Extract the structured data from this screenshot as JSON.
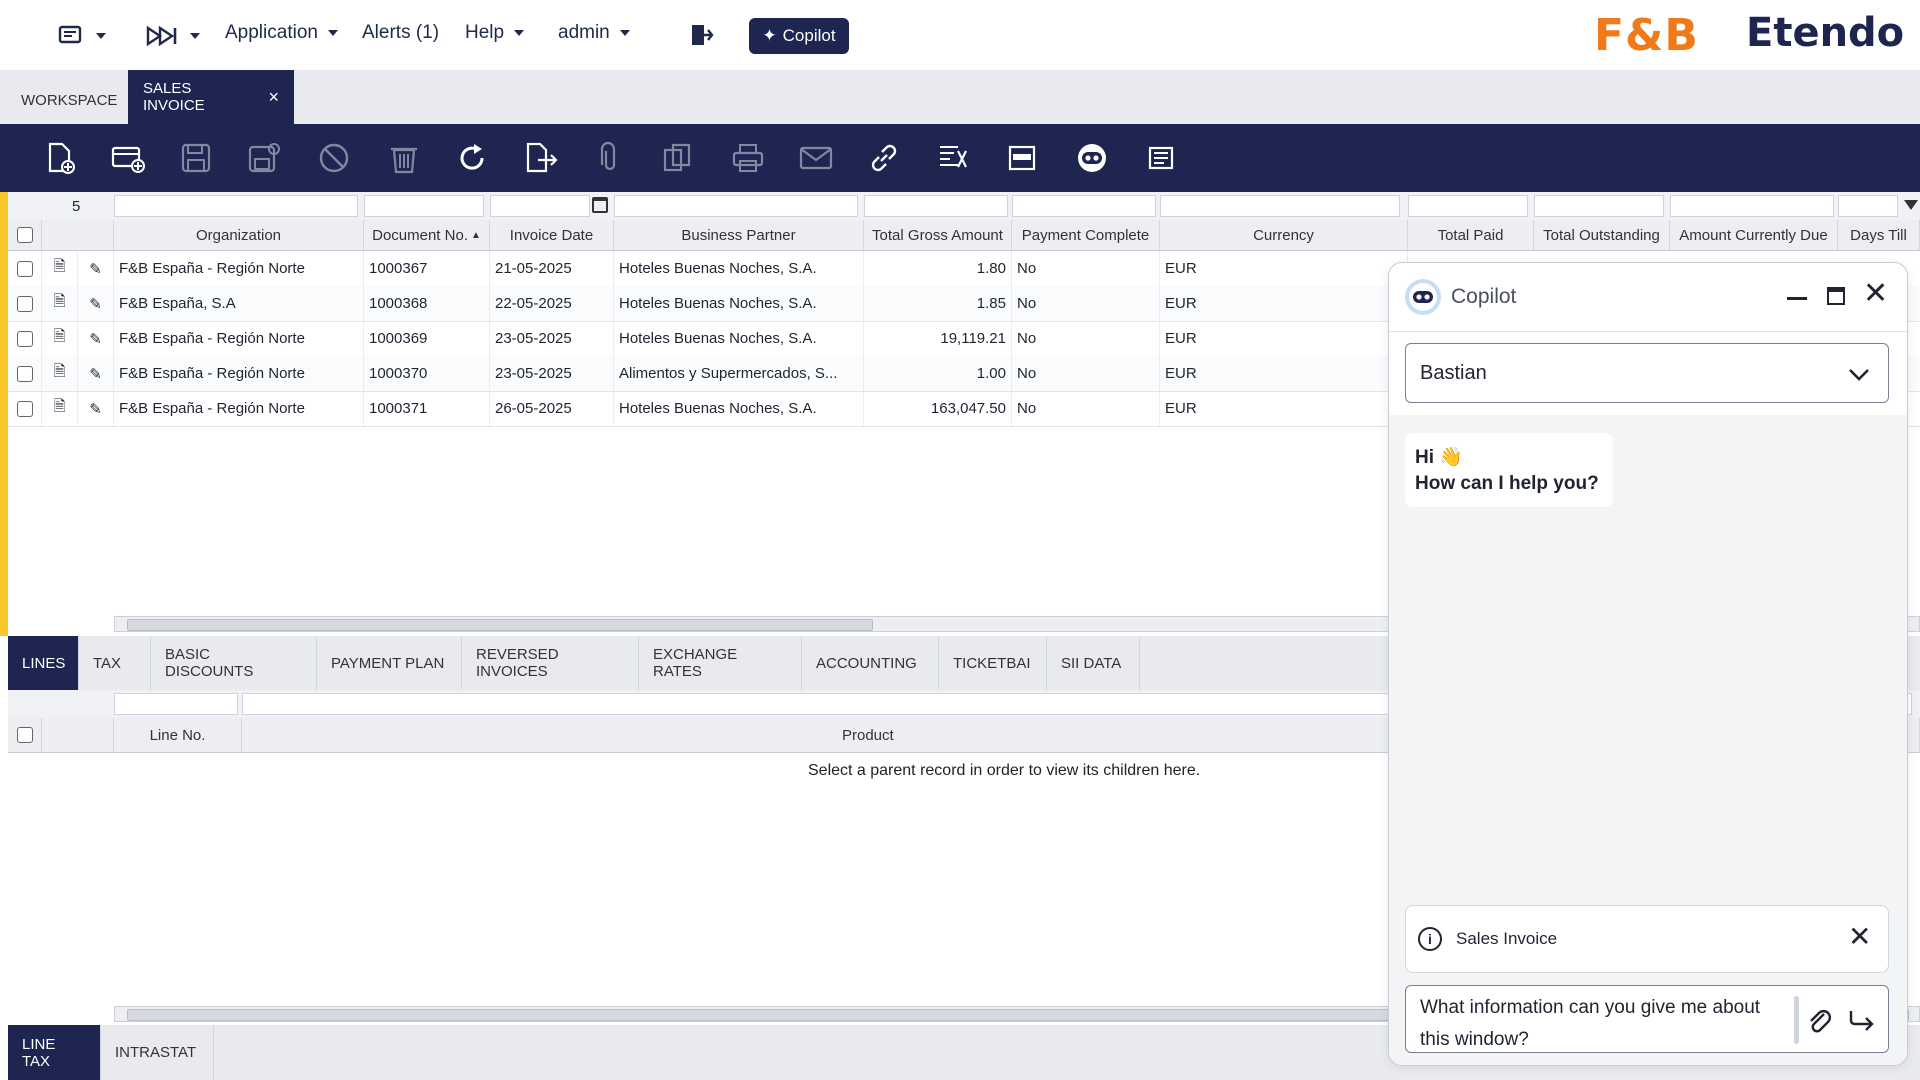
{
  "nav": {
    "application": "Application",
    "alerts": "Alerts (1)",
    "help": "Help",
    "user": "admin",
    "copilot": "Copilot"
  },
  "brand": {
    "logo_text": "F&B",
    "product": "Etendo"
  },
  "window_tabs": [
    {
      "label": "WORKSPACE"
    },
    {
      "label": "SALES INVOICE",
      "close": "×"
    }
  ],
  "toolbar_icons": [
    "new-document-icon",
    "new-row-icon",
    "save-icon",
    "save-close-icon",
    "cancel-icon",
    "delete-icon",
    "refresh-icon",
    "export-icon",
    "attachment-icon",
    "copy-icon",
    "print-icon",
    "email-icon",
    "link-icon",
    "process-icon",
    "form-view-icon",
    "copilot-icon",
    "notes-icon"
  ],
  "grid": {
    "record_count": "5",
    "columns": [
      "Organization",
      "Document No.",
      "Invoice Date",
      "Business Partner",
      "Total Gross Amount",
      "Payment Complete",
      "Currency",
      "Total Paid",
      "Total Outstanding",
      "Amount Currently Due",
      "Days Till"
    ],
    "rows": [
      [
        "F&B España - Región Norte",
        "1000367",
        "21-05-2025",
        "Hoteles Buenas Noches, S.A.",
        "1.80",
        "No",
        "EUR"
      ],
      [
        "F&B España, S.A",
        "1000368",
        "22-05-2025",
        "Hoteles Buenas Noches, S.A.",
        "1.85",
        "No",
        "EUR"
      ],
      [
        "F&B España - Región Norte",
        "1000369",
        "23-05-2025",
        "Hoteles Buenas Noches, S.A.",
        "19,119.21",
        "No",
        "EUR"
      ],
      [
        "F&B España - Región Norte",
        "1000370",
        "23-05-2025",
        "Alimentos y Supermercados, S...",
        "1.00",
        "No",
        "EUR"
      ],
      [
        "F&B España - Región Norte",
        "1000371",
        "26-05-2025",
        "Hoteles Buenas Noches, S.A.",
        "163,047.50",
        "No",
        "EUR"
      ]
    ]
  },
  "child_tabs": [
    "LINES",
    "TAX",
    "BASIC DISCOUNTS",
    "PAYMENT PLAN",
    "REVERSED INVOICES",
    "EXCHANGE RATES",
    "ACCOUNTING",
    "TICKETBAI",
    "SII DATA"
  ],
  "child_grid": {
    "columns": [
      "Line No.",
      "Product"
    ],
    "empty_message": "Select a parent record in order to view its children here."
  },
  "bottom_tabs": [
    "LINE TAX",
    "INTRASTAT"
  ],
  "copilot": {
    "title": "Copilot",
    "assistant": "Bastian",
    "greeting_line1": "Hi 👋",
    "greeting_line2": "How can I help you?",
    "context_label": "Sales Invoice",
    "input_value": "What information can you give me about this window?"
  },
  "colors": {
    "navy": "#1d2550",
    "accent_yellow": "#f7c729",
    "brand_orange": "#f07a19"
  }
}
